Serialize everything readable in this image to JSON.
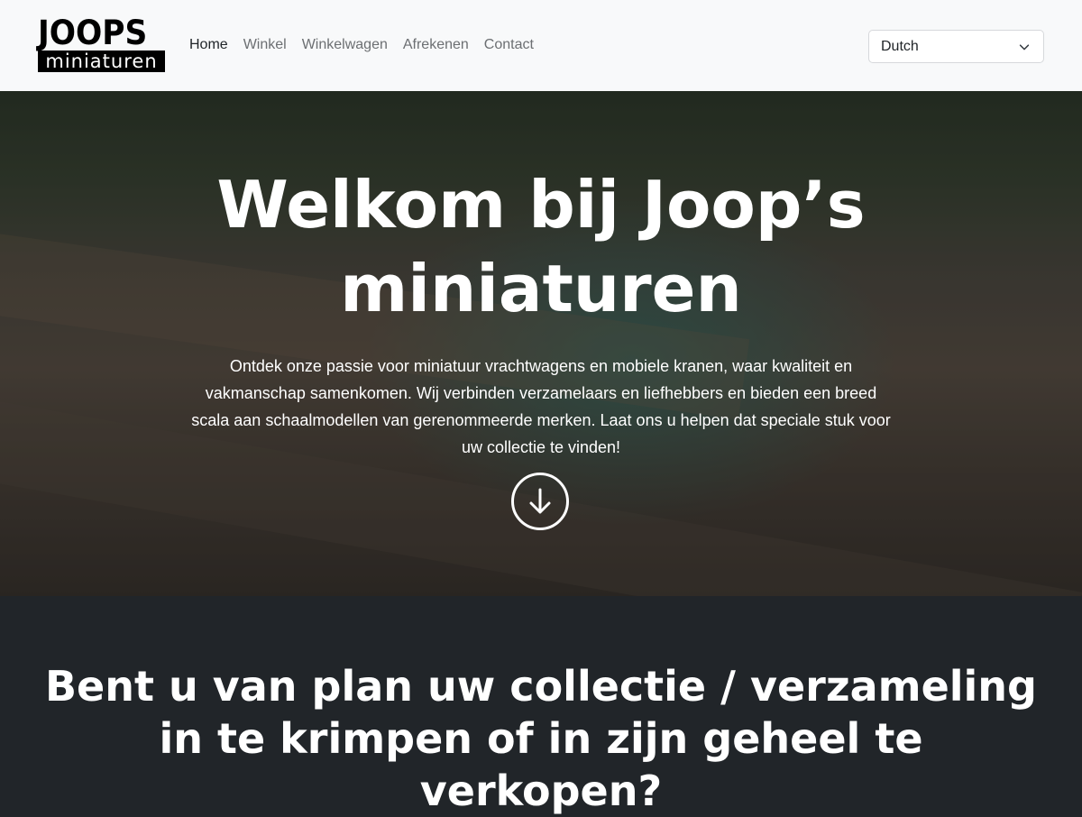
{
  "logo": {
    "top": "JOOPS",
    "bottom": "miniaturen"
  },
  "nav": {
    "home": "Home",
    "shop": "Winkel",
    "cart": "Winkelwagen",
    "checkout": "Afrekenen",
    "contact": "Contact"
  },
  "language": {
    "selected": "Dutch",
    "icon": "chevron-down-icon"
  },
  "hero": {
    "title": "Welkom bij Joop’s miniaturen",
    "text": "Ontdek onze passie voor miniatuur vrachtwagens en mobiele kranen, waar kwaliteit en vakmanschap samenkomen. Wij verbinden verzamelaars en liefhebbers en bieden een breed scala aan schaalmodellen van gerenommeerde merken. Laat ons u helpen dat speciale stuk voor uw collectie te vinden!",
    "scroll_icon": "arrow-down-circle-icon"
  },
  "section": {
    "title": "Bent u van plan uw collectie / verzameling in te krimpen of in zijn geheel te verkopen?"
  },
  "colors": {
    "header_bg": "#f8f9fa",
    "dark_bg": "#212529"
  }
}
